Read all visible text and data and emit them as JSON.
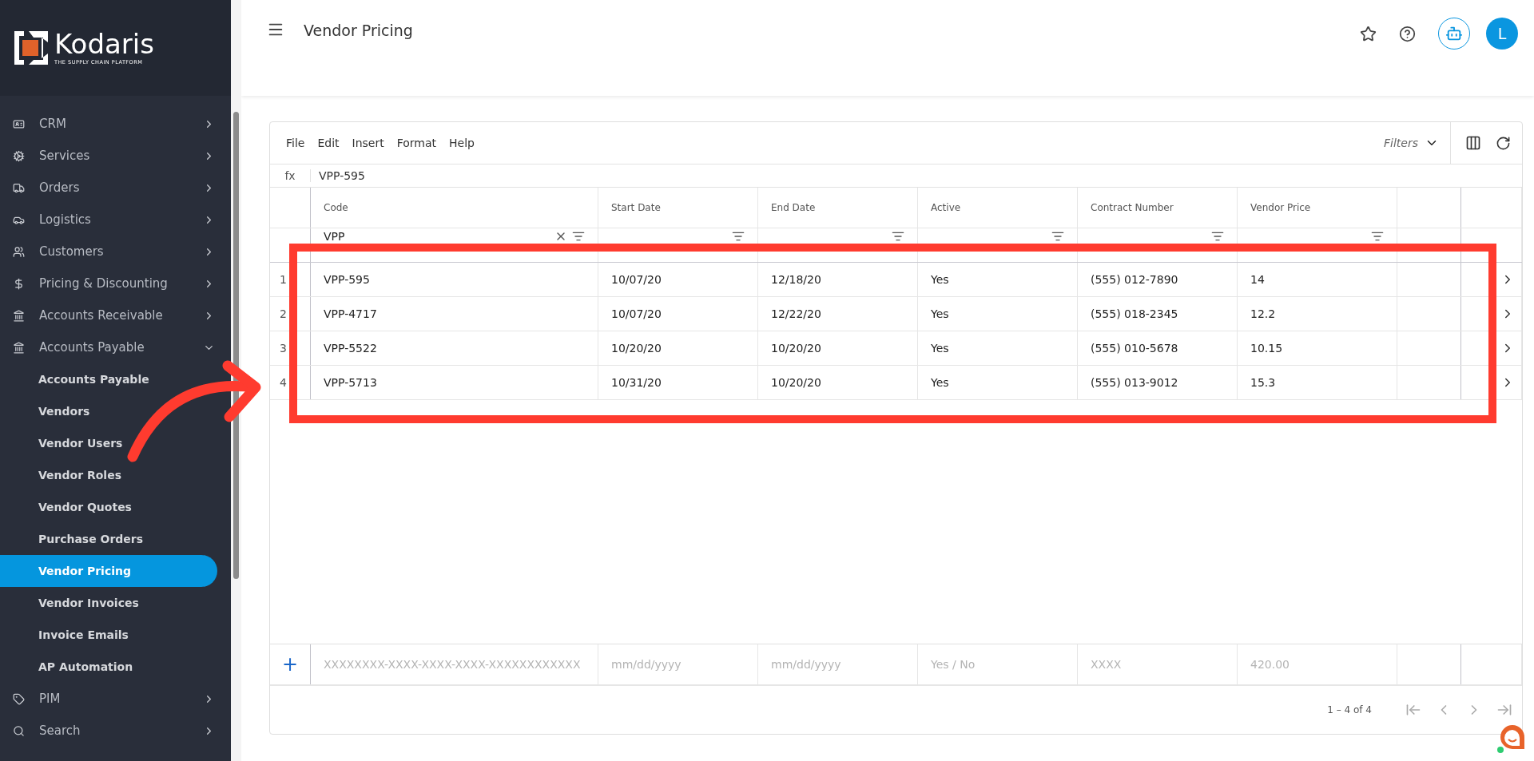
{
  "sidebar": {
    "logo": {
      "name": "Kodaris",
      "tagline": "THE SUPPLY CHAIN PLATFORM"
    },
    "items": [
      {
        "label": "CRM",
        "expanded": false
      },
      {
        "label": "Services",
        "expanded": false
      },
      {
        "label": "Orders",
        "expanded": false
      },
      {
        "label": "Logistics",
        "expanded": false
      },
      {
        "label": "Customers",
        "expanded": false
      },
      {
        "label": "Pricing & Discounting",
        "expanded": false
      },
      {
        "label": "Accounts Receivable",
        "expanded": false
      },
      {
        "label": "Accounts Payable",
        "expanded": true,
        "children": [
          {
            "label": "Accounts Payable",
            "selected": false
          },
          {
            "label": "Vendors",
            "selected": false
          },
          {
            "label": "Vendor Users",
            "selected": false
          },
          {
            "label": "Vendor Roles",
            "selected": false
          },
          {
            "label": "Vendor Quotes",
            "selected": false
          },
          {
            "label": "Purchase Orders",
            "selected": false
          },
          {
            "label": "Vendor Pricing",
            "selected": true
          },
          {
            "label": "Vendor Invoices",
            "selected": false
          },
          {
            "label": "Invoice Emails",
            "selected": false
          },
          {
            "label": "AP Automation",
            "selected": false
          }
        ]
      },
      {
        "label": "PIM",
        "expanded": false
      },
      {
        "label": "Search",
        "expanded": false
      }
    ]
  },
  "header": {
    "title": "Vendor Pricing",
    "avatar": "L"
  },
  "grid": {
    "menu": [
      "File",
      "Edit",
      "Insert",
      "Format",
      "Help"
    ],
    "filters": "Filters",
    "formula": {
      "label": "fx",
      "value": "VPP-595"
    },
    "columns": [
      {
        "label": "Code",
        "filter": "VPP"
      },
      {
        "label": "Start Date"
      },
      {
        "label": "End Date"
      },
      {
        "label": "Active"
      },
      {
        "label": "Contract Number"
      },
      {
        "label": "Vendor Price"
      }
    ],
    "rows": [
      {
        "number": "1",
        "cells": [
          "VPP-595",
          "10/07/20",
          "12/18/20",
          "Yes",
          "(555) 012-7890",
          "14"
        ]
      },
      {
        "number": "2",
        "cells": [
          "VPP-4717",
          "10/07/20",
          "12/22/20",
          "Yes",
          "(555) 018-2345",
          "12.2"
        ]
      },
      {
        "number": "3",
        "cells": [
          "VPP-5522",
          "10/20/20",
          "10/20/20",
          "Yes",
          "(555) 010-5678",
          "10.15"
        ]
      },
      {
        "number": "4",
        "cells": [
          "VPP-5713",
          "10/31/20",
          "10/20/20",
          "Yes",
          "(555) 013-9012",
          "15.3"
        ]
      }
    ],
    "new_row": {
      "add": "+",
      "placeholders": [
        "XXXXXXXX-XXXX-XXXX-XXXX-XXXXXXXXXXXX",
        "mm/dd/yyyy",
        "mm/dd/yyyy",
        "Yes / No",
        "XXXX",
        "420.00"
      ]
    },
    "pagination": "1 – 4 of 4"
  },
  "annotation": {
    "highlight": true,
    "arrow": true
  }
}
